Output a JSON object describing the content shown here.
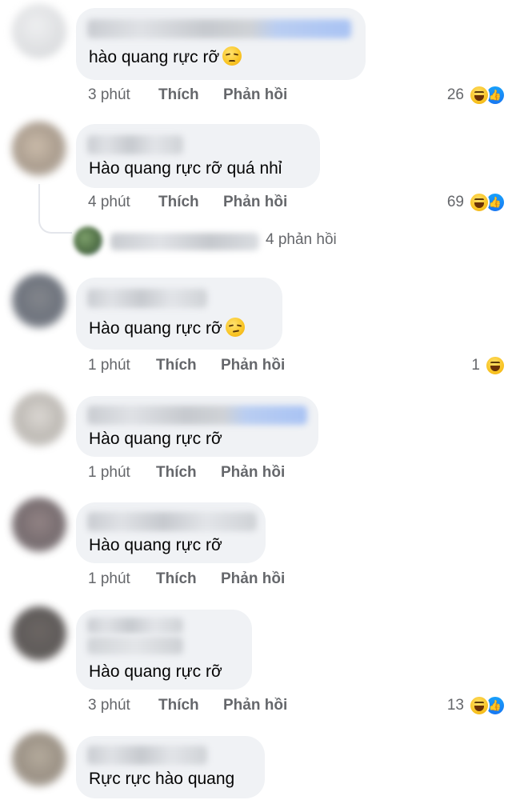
{
  "actions": {
    "like": "Thích",
    "reply": "Phản hồi"
  },
  "reactions_icons": {
    "haha": "haha-react-icon",
    "like": "like-react-icon"
  },
  "comments": [
    {
      "text": "hào quang rực rỡ",
      "emoji": "disappointed-face-emoji",
      "time": "3 phút",
      "reaction_count": "26",
      "reactions": [
        "haha",
        "like"
      ]
    },
    {
      "text": "Hào quang rực rỡ quá nhỉ",
      "emoji": "",
      "time": "4 phút",
      "reaction_count": "69",
      "reactions": [
        "haha",
        "like"
      ],
      "replies_summary": "4 phản hồi"
    },
    {
      "text": "Hào quang rực rỡ",
      "emoji": "smirking-face-emoji",
      "time": "1 phút",
      "reaction_count": "1",
      "reactions": [
        "haha"
      ]
    },
    {
      "text": "Hào quang rực rỡ",
      "emoji": "",
      "time": "1 phút",
      "reaction_count": "",
      "reactions": []
    },
    {
      "text": "Hào quang rực rỡ",
      "emoji": "",
      "time": "1 phút",
      "reaction_count": "",
      "reactions": []
    },
    {
      "text": "Hào quang rực rỡ",
      "emoji": "",
      "time": "3 phút",
      "reaction_count": "13",
      "reactions": [
        "haha",
        "like"
      ]
    },
    {
      "text": "Rực rực hào quang",
      "emoji": "",
      "time": "",
      "reaction_count": "",
      "reactions": []
    }
  ]
}
